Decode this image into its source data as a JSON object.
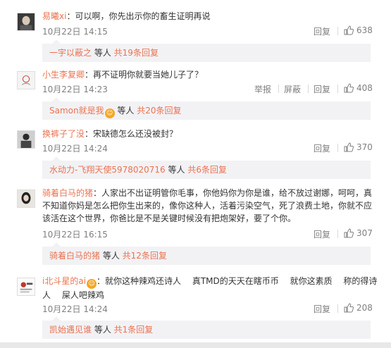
{
  "comments": [
    {
      "user": "易曦xi",
      "text": "：可以啊，你先出示你的畜生证明再说",
      "time": "10月22日 14:15",
      "actions": [
        "回复"
      ],
      "likes": "638",
      "replies": {
        "user": "一宇以蔽之",
        "suffix": " 等人",
        "count": "共19条回复"
      }
    },
    {
      "user": "小生李复卿",
      "text": "：再不证明你就要当她儿子了？",
      "time": "10月22日 14:23",
      "actions": [
        "举报",
        "屏蔽",
        "回复"
      ],
      "likes": "408",
      "replies": {
        "user": "Samon就是我",
        "suffix": " 等人",
        "count": "共20条回复",
        "badge": "☺"
      }
    },
    {
      "user": "换裤子了没",
      "text": "：宋缺德怎么还没被封？",
      "time": "10月22日 14:24",
      "actions": [
        "回复"
      ],
      "likes": "370",
      "replies": {
        "user": "水动力-飞翔天使5978020716",
        "suffix": " 等人",
        "count": "共6条回复"
      }
    },
    {
      "user": "骑着白马的猪",
      "text_lines": [
        "：人家出不出证明管你毛事，你他妈你为你是谁，给不放过谢娜，呵呵，真",
        "不知道你妈是怎么把你生出来的，像你这种人，活着污染空气，死了浪费土地，你就不应",
        "该活在这个世界，你爸比是不是关键时候没有把炮架好，要了个你。"
      ],
      "time": "10月22日 16:15",
      "actions": [
        "回复"
      ],
      "likes": "307",
      "replies": {
        "user": "骑着白马的猪",
        "suffix": " 等人",
        "count": "共12条回复"
      }
    },
    {
      "user": "i北斗星的ai",
      "badge": "☺",
      "text_lines": [
        "：就你这种辣鸡还诗人　 真TMD的天天在瞎币币　 就你这素质　 称的得诗",
        "人　 屎人吧辣鸡"
      ],
      "time": "10月22日 14:24",
      "actions": [
        "回复"
      ],
      "likes": "208",
      "replies": {
        "user": "凯始遇见谁",
        "suffix": " 等人",
        "count": "共1条回复"
      }
    }
  ],
  "colors": {
    "name": "#eb7350",
    "meta": "#808080",
    "reply_bg": "#f2f2f5"
  },
  "icons": {
    "like": "thumbs-up-icon",
    "badge": "emoji-badge-icon"
  }
}
